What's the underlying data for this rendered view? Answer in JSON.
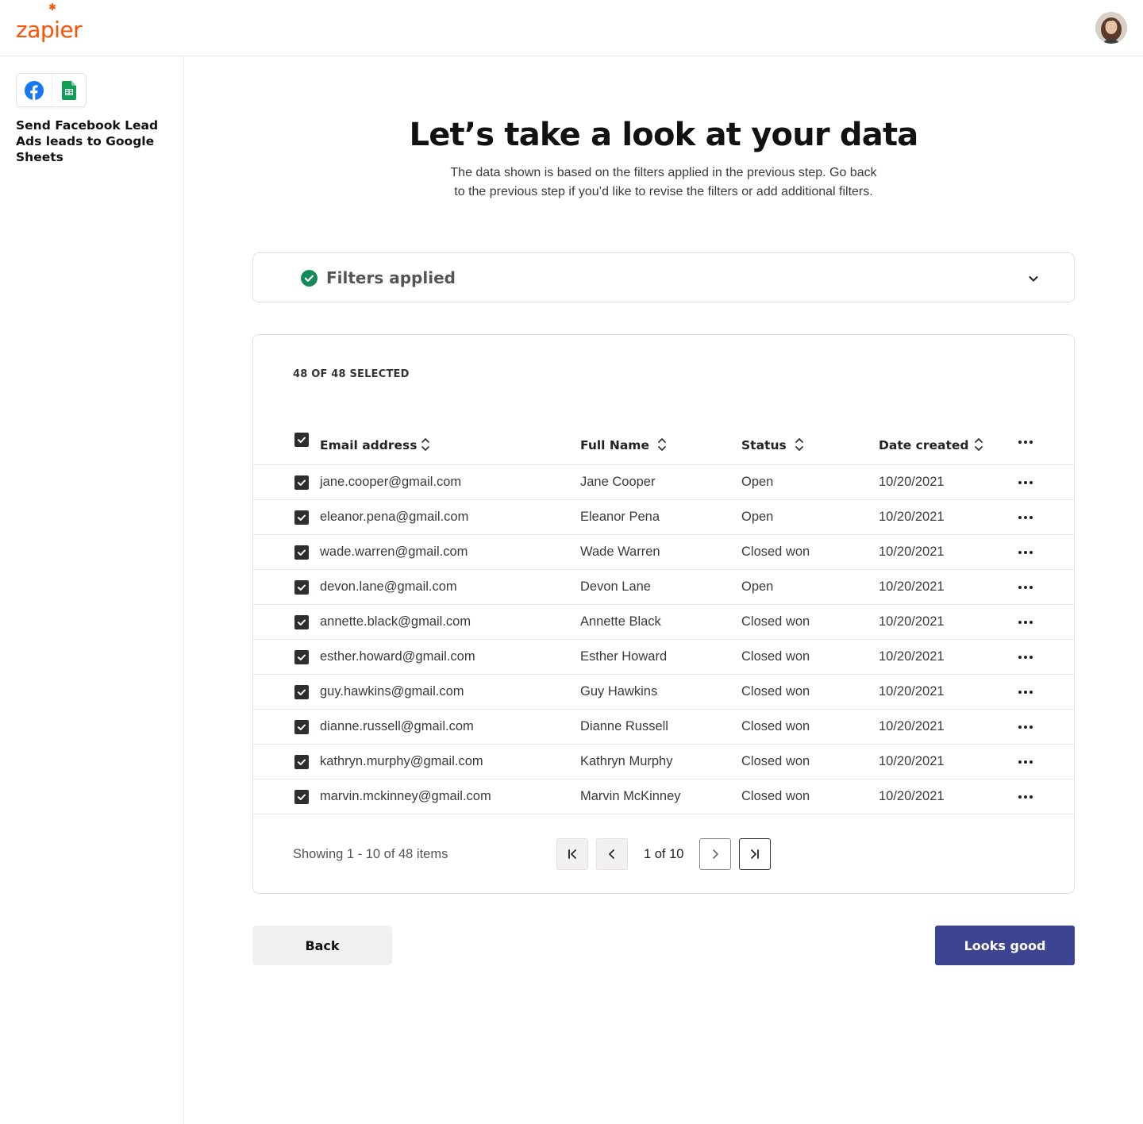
{
  "brand": {
    "logo_text": "zapier",
    "accent": "#ff4f00"
  },
  "sidebar": {
    "apps": [
      "facebook-lead-ads-icon",
      "google-sheets-icon"
    ],
    "zap_title": "Send Facebook Lead Ads leads to Google Sheets"
  },
  "main": {
    "heading": "Let’s take a look at your data",
    "subtext": "The data shown is based on the filters applied in the previous step. Go back to the previous step if you’d like to revise the filters or add additional filters.",
    "filters_label": "Filters applied",
    "selected_count": "48 OF 48 SELECTED"
  },
  "table": {
    "columns": [
      "Email address",
      "Full Name",
      "Status",
      "Date created"
    ],
    "rows": [
      {
        "email": "jane.cooper@gmail.com",
        "name": "Jane Cooper",
        "status": "Open",
        "date": "10/20/2021",
        "checked": true
      },
      {
        "email": "eleanor.pena@gmail.com",
        "name": "Eleanor Pena",
        "status": "Open",
        "date": "10/20/2021",
        "checked": true
      },
      {
        "email": "wade.warren@gmail.com",
        "name": "Wade Warren",
        "status": "Closed won",
        "date": "10/20/2021",
        "checked": true
      },
      {
        "email": "devon.lane@gmail.com",
        "name": "Devon Lane",
        "status": "Open",
        "date": "10/20/2021",
        "checked": true
      },
      {
        "email": "annette.black@gmail.com",
        "name": "Annette Black",
        "status": "Closed won",
        "date": "10/20/2021",
        "checked": true
      },
      {
        "email": "esther.howard@gmail.com",
        "name": "Esther Howard",
        "status": "Closed won",
        "date": "10/20/2021",
        "checked": true
      },
      {
        "email": "guy.hawkins@gmail.com",
        "name": "Guy Hawkins",
        "status": "Closed won",
        "date": "10/20/2021",
        "checked": true
      },
      {
        "email": "dianne.russell@gmail.com",
        "name": "Dianne Russell",
        "status": "Closed won",
        "date": "10/20/2021",
        "checked": true
      },
      {
        "email": "kathryn.murphy@gmail.com",
        "name": "Kathryn Murphy",
        "status": "Closed won",
        "date": "10/20/2021",
        "checked": true
      },
      {
        "email": "marvin.mckinney@gmail.com",
        "name": "Marvin McKinney",
        "status": "Closed won",
        "date": "10/20/2021",
        "checked": true
      }
    ]
  },
  "pagination": {
    "showing_text": "Showing 1 - 10 of 48 items",
    "page_label": "1 of 10"
  },
  "actions": {
    "back_label": "Back",
    "confirm_label": "Looks good",
    "confirm_color": "#3d4592"
  }
}
